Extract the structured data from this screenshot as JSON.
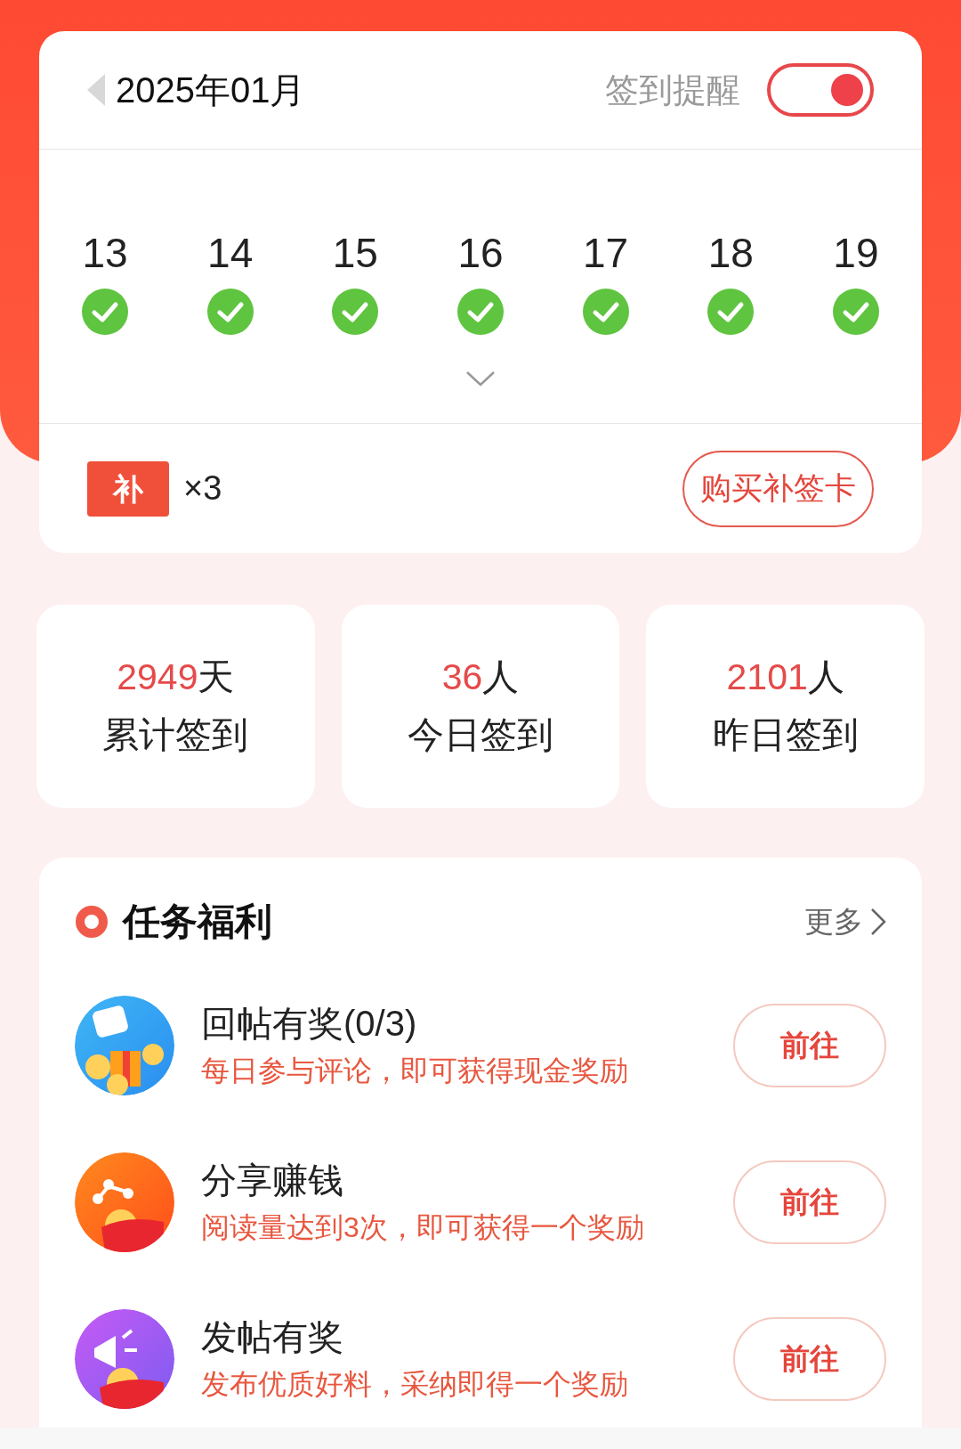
{
  "header": {
    "month": "2025年01月",
    "reminder_label": "签到提醒",
    "reminder_on": true
  },
  "days": [
    {
      "day": "13",
      "checked": true
    },
    {
      "day": "14",
      "checked": true
    },
    {
      "day": "15",
      "checked": true
    },
    {
      "day": "16",
      "checked": true
    },
    {
      "day": "17",
      "checked": true
    },
    {
      "day": "18",
      "checked": true
    },
    {
      "day": "19",
      "checked": true
    }
  ],
  "makeup": {
    "icon_text": "补",
    "count": "×3",
    "button": "购买补签卡"
  },
  "stats": [
    {
      "value": "2949",
      "unit": "天",
      "label": "累计签到"
    },
    {
      "value": "36",
      "unit": "人",
      "label": "今日签到"
    },
    {
      "value": "2101",
      "unit": "人",
      "label": "昨日签到"
    }
  ],
  "tasks": {
    "title": "任务福利",
    "more": "更多",
    "items": [
      {
        "kind": "chat",
        "title": "回帖有奖(0/3)",
        "desc": "每日参与评论，即可获得现金奖励",
        "button": "前往"
      },
      {
        "kind": "share",
        "title": "分享赚钱",
        "desc": "阅读量达到3次，即可获得一个奖励",
        "button": "前往"
      },
      {
        "kind": "megaphone",
        "title": "发帖有奖",
        "desc": "发布优质好料，采纳即得一个奖励",
        "button": "前往"
      }
    ]
  }
}
